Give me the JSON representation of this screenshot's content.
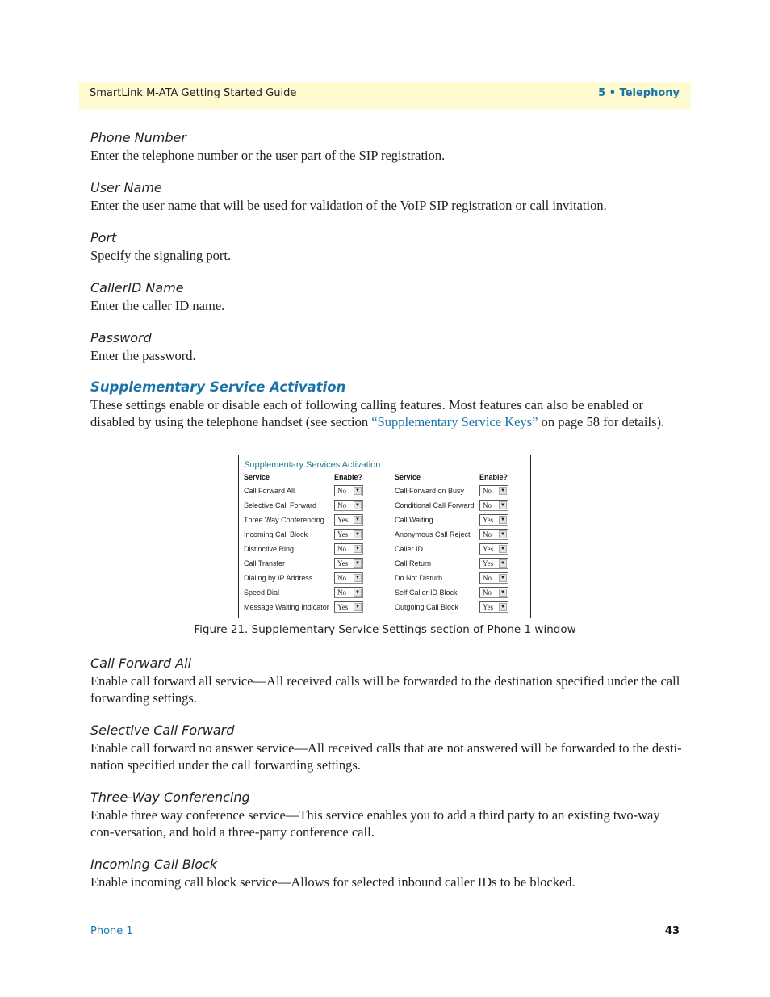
{
  "header": {
    "title": "SmartLink M-ATA Getting Started Guide",
    "chapter": "5 • Telephony"
  },
  "fields": [
    {
      "term": "Phone Number",
      "desc": "Enter the telephone number or the user part of the SIP registration."
    },
    {
      "term": "User Name",
      "desc": "Enter the user name that will be used for validation of the VoIP SIP registration or call invitation."
    },
    {
      "term": "Port",
      "desc": "Specify the signaling port."
    },
    {
      "term": "CallerID Name",
      "desc": "Enter the caller ID name."
    },
    {
      "term": "Password",
      "desc": "Enter the password."
    }
  ],
  "section": {
    "title": "Supplementary Service Activation",
    "intro_before": "These settings enable or disable each of following calling features. Most features can also be enabled or disabled by using the telephone handset (see section ",
    "intro_link": "“Supplementary Service Keys”",
    "intro_after": " on page 58 for details)."
  },
  "figure": {
    "title": "Supplementary Services Activation",
    "col_service": "Service",
    "col_enable": "Enable?",
    "left": [
      {
        "service": "Call Forward All",
        "value": "No"
      },
      {
        "service": "Selective Call Forward",
        "value": "No"
      },
      {
        "service": "Three Way Conferencing",
        "value": "Yes"
      },
      {
        "service": "Incoming Call Block",
        "value": "Yes"
      },
      {
        "service": "Distinctive Ring",
        "value": "No"
      },
      {
        "service": "Call Transfer",
        "value": "Yes"
      },
      {
        "service": "Dialing by IP Address",
        "value": "No"
      },
      {
        "service": "Speed Dial",
        "value": "No"
      },
      {
        "service": "Message Waiting Indicator",
        "value": "Yes"
      }
    ],
    "right": [
      {
        "service": "Call Forward on Busy",
        "value": "No"
      },
      {
        "service": "Conditional Call Forward",
        "value": "No"
      },
      {
        "service": "Call Waiting",
        "value": "Yes"
      },
      {
        "service": "Anonymous Call Reject",
        "value": "No"
      },
      {
        "service": "Caller ID",
        "value": "Yes"
      },
      {
        "service": "Call Return",
        "value": "Yes"
      },
      {
        "service": "Do Not Disturb",
        "value": "No"
      },
      {
        "service": "Self Caller ID Block",
        "value": "No"
      },
      {
        "service": "Outgoing Call Block",
        "value": "Yes"
      }
    ],
    "caption": "Figure 21. Supplementary Service Settings section of Phone 1 window"
  },
  "features": [
    {
      "term": "Call Forward All",
      "desc": "Enable call forward all service—All received calls will be forwarded to the destination specified under the call forwarding settings."
    },
    {
      "term": "Selective Call Forward",
      "desc": "Enable call forward no answer service—All received calls that are not answered will be forwarded to the desti-nation specified under the call forwarding settings."
    },
    {
      "term": "Three-Way Conferencing",
      "desc": "Enable three way conference service—This service enables you to add a third party to an existing two-way con-versation, and hold a three-party conference call."
    },
    {
      "term": "Incoming Call Block",
      "desc": "Enable incoming call block service—Allows for selected inbound caller IDs to be blocked."
    }
  ],
  "footer": {
    "section": "Phone 1",
    "page": "43"
  }
}
